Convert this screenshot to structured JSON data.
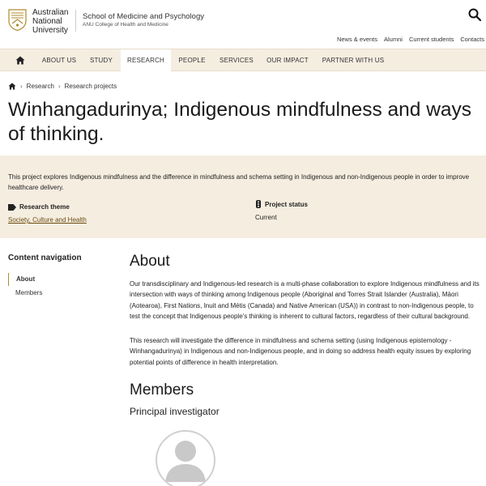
{
  "header": {
    "logo_text": [
      "Australian",
      "National",
      "University"
    ],
    "school_name": "School of Medicine and Psychology",
    "college_name": "ANU College of Health and Medicine",
    "utility_nav": [
      "News & events",
      "Alumni",
      "Current students",
      "Contacts"
    ],
    "search_icon": "search-icon"
  },
  "main_nav": {
    "items": [
      "ABOUT US",
      "STUDY",
      "RESEARCH",
      "PEOPLE",
      "SERVICES",
      "OUR IMPACT",
      "PARTNER WITH US"
    ],
    "active": "RESEARCH",
    "home_icon": "home-icon"
  },
  "breadcrumb": {
    "items": [
      "Research",
      "Research projects"
    ]
  },
  "page_title": "Winhangadurinya; Indigenous mindfulness and ways of thinking.",
  "summary": {
    "text": "This project explores Indigenous mindfulness and the difference in mindfulness and schema setting in Indigenous and non-Indigenous people in order to improve healthcare delivery.",
    "theme_label": "Research theme",
    "theme_value": "Society, Culture and Health",
    "status_label": "Project status",
    "status_value": "Current"
  },
  "content_nav": {
    "title": "Content navigation",
    "items": [
      "About",
      "Members"
    ],
    "active": "About"
  },
  "about": {
    "heading": "About",
    "paragraphs": [
      "Our transdisciplinary and Indigenous-led research is a multi-phase collaboration to explore Indigenous mindfulness and its intersection with ways of thinking among Indigenous people (Aboriginal and Torres Strait Islander (Australia), Māori (Aotearoa), First Nations, Inuit and Métis (Canada) and Native American (USA)) in contrast to non-Indigenous people, to test the concept that Indigenous people's thinking is inherent to cultural factors, regardless of their cultural background.",
      "This research will investigate the difference in mindfulness and schema setting (using Indigenous epistemology - Winhangadurinya) in Indigenous and non-Indigenous people, and in doing so address health equity issues by exploring potential points of difference in health interpretation."
    ]
  },
  "members": {
    "heading": "Members",
    "principal_investigator_heading": "Principal investigator"
  },
  "colors": {
    "band": "#f5ede0",
    "link": "#6b4c10",
    "accent": "#b08a2e"
  }
}
